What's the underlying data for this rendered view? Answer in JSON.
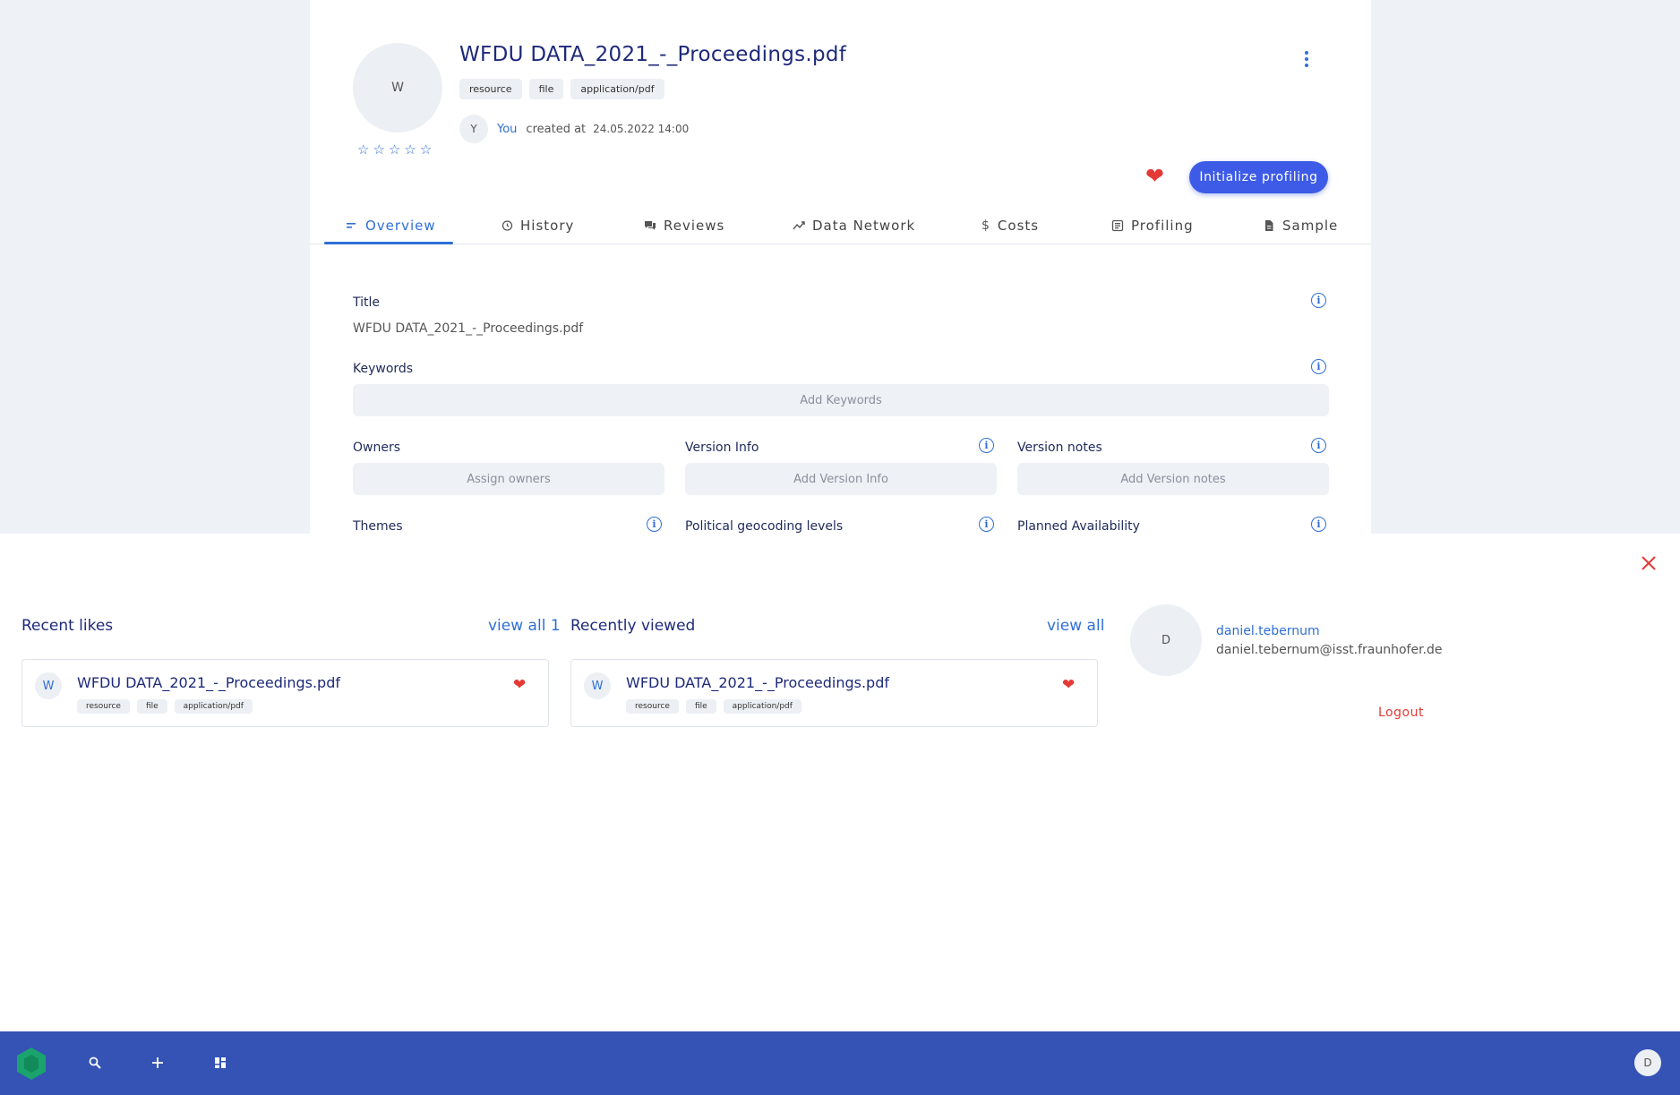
{
  "resource": {
    "avatar_letter": "W",
    "rating_stars": [
      "☆",
      "☆",
      "☆",
      "☆",
      "☆"
    ],
    "title": "WFDU DATA_2021_-_Proceedings.pdf",
    "tags": [
      "resource",
      "file",
      "application/pdf"
    ],
    "creator_avatar": "Y",
    "creator_name": "You",
    "created_label": "created at",
    "created_date": "24.05.2022 14:00",
    "like_icon": "heart-icon",
    "liked": true
  },
  "actions": {
    "init_profiling_label": "Initialize profiling"
  },
  "tabs": [
    {
      "label": "Overview",
      "icon": "list-icon",
      "active": true
    },
    {
      "label": "History",
      "icon": "history-icon",
      "active": false
    },
    {
      "label": "Reviews",
      "icon": "chat-icon",
      "active": false
    },
    {
      "label": "Data Network",
      "icon": "trend-icon",
      "active": false
    },
    {
      "label": "Costs",
      "icon": "dollar-icon",
      "active": false
    },
    {
      "label": "Profiling",
      "icon": "profiling-icon",
      "active": false
    },
    {
      "label": "Sample",
      "icon": "document-icon",
      "active": false
    }
  ],
  "overview": {
    "title_label": "Title",
    "title_value": "WFDU DATA_2021_-_Proceedings.pdf",
    "keywords_label": "Keywords",
    "keywords_placeholder": "Add Keywords",
    "owners_label": "Owners",
    "owners_placeholder": "Assign owners",
    "version_info_label": "Version Info",
    "version_info_placeholder": "Add Version Info",
    "version_notes_label": "Version notes",
    "version_notes_placeholder": "Add Version notes",
    "themes_label": "Themes",
    "geocoding_label": "Political geocoding levels",
    "availability_label": "Planned Availability"
  },
  "panel": {
    "recent_likes": {
      "title": "Recent likes",
      "view_all": "view all 1",
      "items": [
        {
          "avatar": "W",
          "title": "WFDU DATA_2021_-_Proceedings.pdf",
          "tags": [
            "resource",
            "file",
            "application/pdf"
          ],
          "liked": true
        }
      ]
    },
    "recently_viewed": {
      "title": "Recently viewed",
      "view_all": "view all",
      "items": [
        {
          "avatar": "W",
          "title": "WFDU DATA_2021_-_Proceedings.pdf",
          "tags": [
            "resource",
            "file",
            "application/pdf"
          ],
          "liked": true
        }
      ]
    },
    "user": {
      "avatar": "D",
      "username": "daniel.tebernum",
      "email": "daniel.tebernum@isst.fraunhofer.de",
      "logout": "Logout"
    }
  },
  "taskbar": {
    "icons": [
      "logo-icon",
      "search-icon",
      "plus-icon",
      "dashboard-icon"
    ],
    "user_avatar": "D"
  },
  "colors": {
    "accent": "#2f6fd6",
    "primary_button": "#3d5be7",
    "taskbar": "#3453b5",
    "like": "#e53935",
    "logo": "#1aa36c"
  }
}
